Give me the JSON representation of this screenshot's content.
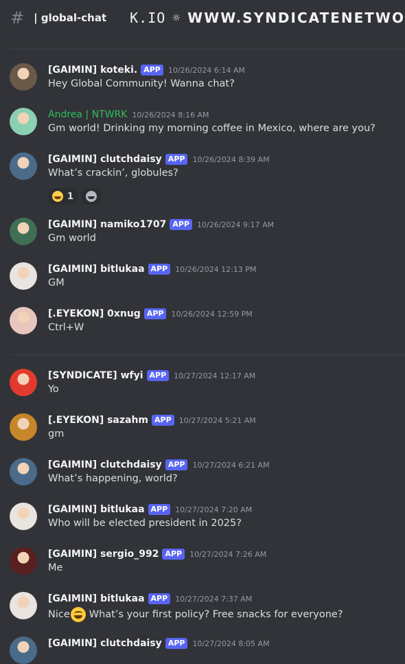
{
  "header": {
    "channel_name": "| global-chat",
    "topic_left": "K.IO",
    "topic_right": "WWW.SYNDICATENETWO"
  },
  "messages": [
    {
      "username": "[GAIMIN] koteki.",
      "app_badge": "APP",
      "timestamp": "10/26/2024 6:14 AM",
      "content": "Hey Global Community! Wanna chat?",
      "avatar_color": "#6b5a4a"
    },
    {
      "username": "Andrea | NTWRK",
      "timestamp": "10/26/2024 8:16 AM",
      "content": "Gm world! Drinking my morning coffee in Mexico, where are you?",
      "avatar_color": "#8ad0b2"
    },
    {
      "username": "[GAIMIN] clutchdaisy",
      "app_badge": "APP",
      "timestamp": "10/26/2024 8:39 AM",
      "content": "What’s crackin’, globules?",
      "avatar_color": "#4a6b8a",
      "reactions": [
        {
          "emoji": "joy",
          "count": "1"
        },
        {
          "emoji": "add-reaction"
        }
      ]
    },
    {
      "username": "[GAIMIN] namiko1707",
      "app_badge": "APP",
      "timestamp": "10/26/2024 9:17 AM",
      "content": "Gm world",
      "avatar_color": "#3f6f55"
    },
    {
      "username": "[GAIMIN] bitlukaa",
      "app_badge": "APP",
      "timestamp": "10/26/2024 12:13 PM",
      "content": "GM",
      "avatar_color": "#e9e4df"
    },
    {
      "username": "[.EYEKON] 0xnug",
      "app_badge": "APP",
      "timestamp": "10/26/2024 12:59 PM",
      "content": "Ctrl+W",
      "avatar_color": "#e9c6bd"
    },
    {
      "username": "[SYNDICATE] wfyi",
      "app_badge": "APP",
      "timestamp": "10/27/2024 12:17 AM",
      "content": "Yo",
      "avatar_color": "#e23b2e"
    },
    {
      "username": "[.EYEKON] sazahm",
      "app_badge": "APP",
      "timestamp": "10/27/2024 5:21 AM",
      "content": "gm",
      "avatar_color": "#c6862a"
    },
    {
      "username": "[GAIMIN] clutchdaisy",
      "app_badge": "APP",
      "timestamp": "10/27/2024 6:21 AM",
      "content": "What’s happening, world?",
      "avatar_color": "#4a6b8a"
    },
    {
      "username": "[GAIMIN] bitlukaa",
      "app_badge": "APP",
      "timestamp": "10/27/2024 7:20 AM",
      "content": "Who will be elected president in 2025?",
      "avatar_color": "#e9e4df"
    },
    {
      "username": "[GAIMIN] sergio_992",
      "app_badge": "APP",
      "timestamp": "10/27/2024 7:26 AM",
      "content": "Me",
      "avatar_color": "#5a1f1f"
    },
    {
      "username": "[GAIMIN] bitlukaa",
      "app_badge": "APP",
      "timestamp": "10/27/2024 7:37 AM",
      "content_before_emoji": "Nice",
      "inline_emoji": "smile",
      "content": "What’s your first policy? Free snacks for everyone?",
      "avatar_color": "#e9e4df"
    },
    {
      "username": "[GAIMIN] clutchdaisy",
      "app_badge": "APP",
      "timestamp": "10/27/2024 8:05 AM",
      "content": "",
      "avatar_color": "#4a6b8a"
    }
  ]
}
